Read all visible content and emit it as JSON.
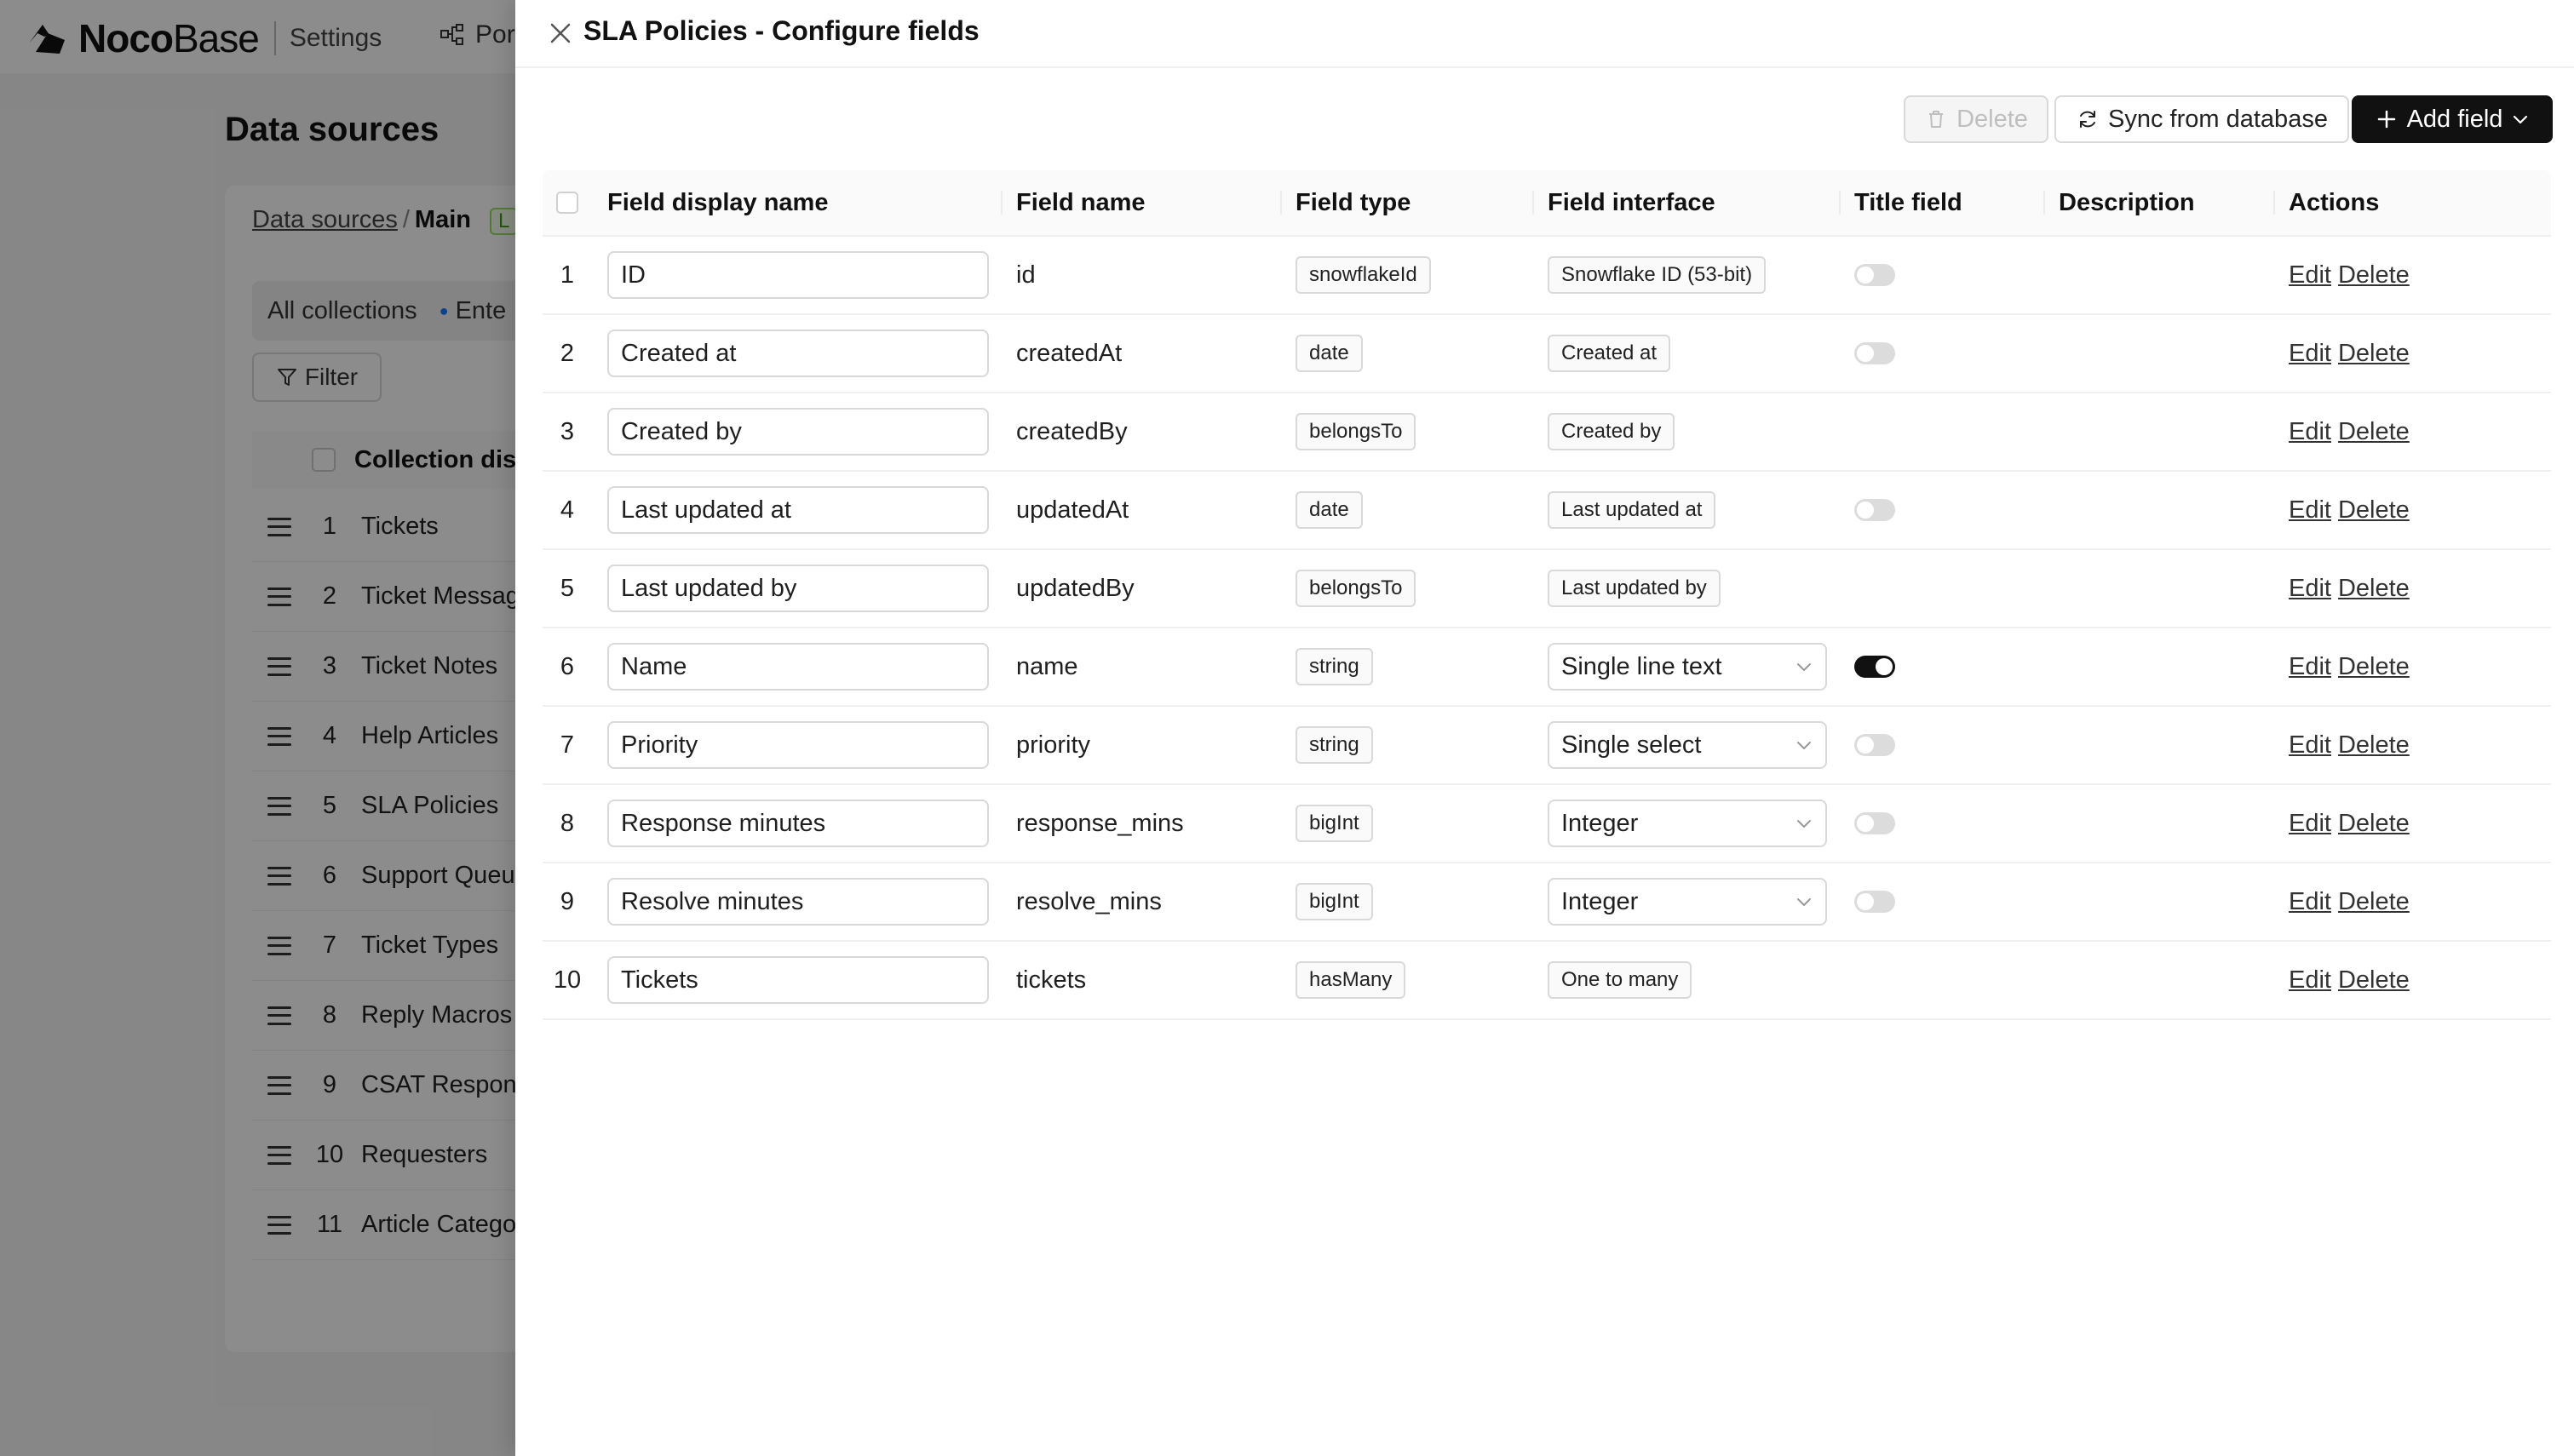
{
  "background": {
    "brand_bold": "Noco",
    "brand_light": "Base",
    "settings_label": "Settings",
    "nav_item": "Por",
    "page_title": "Data sources",
    "breadcrumb": {
      "link": "Data sources",
      "separator": "/",
      "current": "Main",
      "badge": "L"
    },
    "tabs": {
      "all": "All collections",
      "second": "Ente"
    },
    "filter_label": "Filter",
    "table_header": "Collection dis",
    "collections": [
      {
        "index": "1",
        "name": "Tickets"
      },
      {
        "index": "2",
        "name": "Ticket Messag"
      },
      {
        "index": "3",
        "name": "Ticket Notes"
      },
      {
        "index": "4",
        "name": "Help Articles"
      },
      {
        "index": "5",
        "name": "SLA Policies"
      },
      {
        "index": "6",
        "name": "Support Queu"
      },
      {
        "index": "7",
        "name": "Ticket Types"
      },
      {
        "index": "8",
        "name": "Reply Macros"
      },
      {
        "index": "9",
        "name": "CSAT Respon"
      },
      {
        "index": "10",
        "name": "Requesters"
      },
      {
        "index": "11",
        "name": "Article Catego"
      }
    ]
  },
  "drawer": {
    "title": "SLA Policies - Configure fields",
    "toolbar": {
      "delete_label": "Delete",
      "sync_label": "Sync from database",
      "add_label": "Add field"
    },
    "columns": {
      "display_name": "Field display name",
      "field_name": "Field name",
      "field_type": "Field type",
      "field_interface": "Field interface",
      "title_field": "Title field",
      "description": "Description",
      "actions": "Actions"
    },
    "actions": {
      "edit": "Edit",
      "delete": "Delete"
    },
    "rows": [
      {
        "index": "1",
        "display_name": "ID",
        "field_name": "id",
        "field_type": "snowflakeId",
        "interface": "Snowflake ID (53-bit)",
        "interface_kind": "tag",
        "title_toggle": "off"
      },
      {
        "index": "2",
        "display_name": "Created at",
        "field_name": "createdAt",
        "field_type": "date",
        "interface": "Created at",
        "interface_kind": "tag",
        "title_toggle": "off"
      },
      {
        "index": "3",
        "display_name": "Created by",
        "field_name": "createdBy",
        "field_type": "belongsTo",
        "interface": "Created by",
        "interface_kind": "tag",
        "title_toggle": "none"
      },
      {
        "index": "4",
        "display_name": "Last updated at",
        "field_name": "updatedAt",
        "field_type": "date",
        "interface": "Last updated at",
        "interface_kind": "tag",
        "title_toggle": "off"
      },
      {
        "index": "5",
        "display_name": "Last updated by",
        "field_name": "updatedBy",
        "field_type": "belongsTo",
        "interface": "Last updated by",
        "interface_kind": "tag",
        "title_toggle": "none"
      },
      {
        "index": "6",
        "display_name": "Name",
        "field_name": "name",
        "field_type": "string",
        "interface": "Single line text",
        "interface_kind": "select",
        "title_toggle": "on"
      },
      {
        "index": "7",
        "display_name": "Priority",
        "field_name": "priority",
        "field_type": "string",
        "interface": "Single select",
        "interface_kind": "select",
        "title_toggle": "off"
      },
      {
        "index": "8",
        "display_name": "Response minutes",
        "field_name": "response_mins",
        "field_type": "bigInt",
        "interface": "Integer",
        "interface_kind": "select",
        "title_toggle": "off"
      },
      {
        "index": "9",
        "display_name": "Resolve minutes",
        "field_name": "resolve_mins",
        "field_type": "bigInt",
        "interface": "Integer",
        "interface_kind": "select",
        "title_toggle": "off"
      },
      {
        "index": "10",
        "display_name": "Tickets",
        "field_name": "tickets",
        "field_type": "hasMany",
        "interface": "One to many",
        "interface_kind": "tag",
        "title_toggle": "none"
      }
    ]
  },
  "colors": {
    "accent": "#111111",
    "mask": "rgba(0,0,0,0.45)",
    "badge_green": "#389e0d",
    "dot_blue": "#1677ff"
  }
}
